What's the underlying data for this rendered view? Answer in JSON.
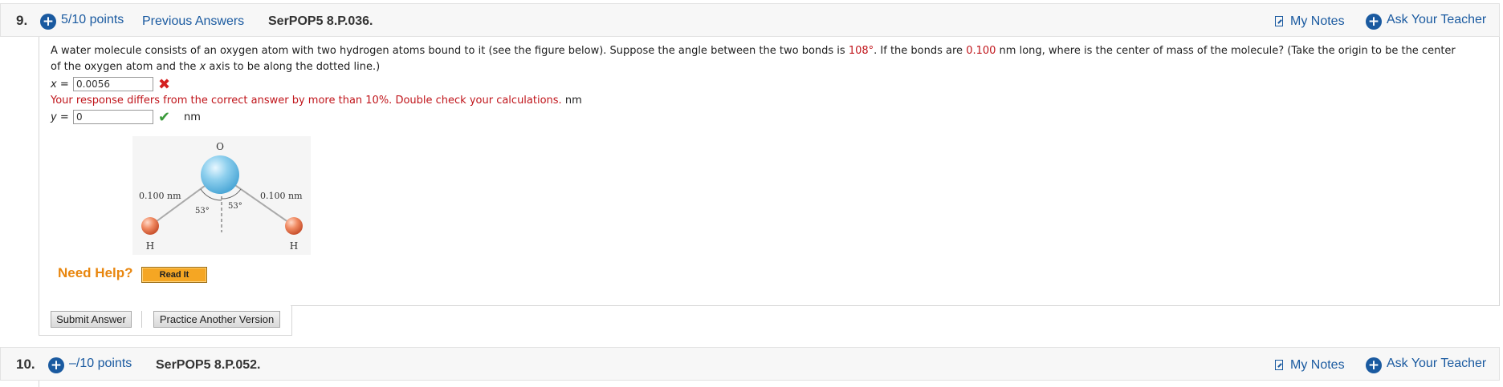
{
  "questions": [
    {
      "number": "9.",
      "points": "5/10 points",
      "previous_answers": "Previous Answers",
      "code": "SerPOP5 8.P.036.",
      "my_notes": "My Notes",
      "ask_teacher": "Ask Your Teacher"
    },
    {
      "number": "10.",
      "points": "–/10 points",
      "code": "SerPOP5 8.P.052.",
      "my_notes": "My Notes",
      "ask_teacher": "Ask Your Teacher"
    }
  ],
  "problem": {
    "text_part1": "A water molecule consists of an oxygen atom with two hydrogen atoms bound to it (see the figure below). Suppose the angle between the two bonds is ",
    "angle": "108°",
    "text_part2": ". If the bonds are ",
    "length": "0.100",
    "text_part3": " nm long, where is the center of mass of the molecule? (Take the origin to be the center",
    "text_line2a": "of the oxygen atom and the ",
    "text_line2_var": "x",
    "text_line2b": " axis to be along the dotted line.)"
  },
  "answers": {
    "x_label": "x =",
    "x_value": "0.0056",
    "x_status_icon": "cross-icon",
    "feedback": "Your response differs from the correct answer by more than 10%. Double check your calculations.",
    "feedback_unit": "nm",
    "y_label": "y =",
    "y_value": "0",
    "y_status_icon": "check-icon",
    "y_unit": "nm"
  },
  "figure": {
    "atom_o": "O",
    "atom_h_left": "H",
    "atom_h_right": "H",
    "bond_left_label": "0.100 nm",
    "bond_right_label": "0.100 nm",
    "angle_left_label": "53°",
    "angle_right_label": "53°"
  },
  "help": {
    "label": "Need Help?",
    "read_it": "Read It"
  },
  "buttons": {
    "submit": "Submit Answer",
    "practice": "Practice Another Version"
  },
  "colors": {
    "link": "#1a5aa0",
    "error": "#c0151b",
    "help": "#e8860e",
    "read_it_bg": "#f5a623"
  }
}
